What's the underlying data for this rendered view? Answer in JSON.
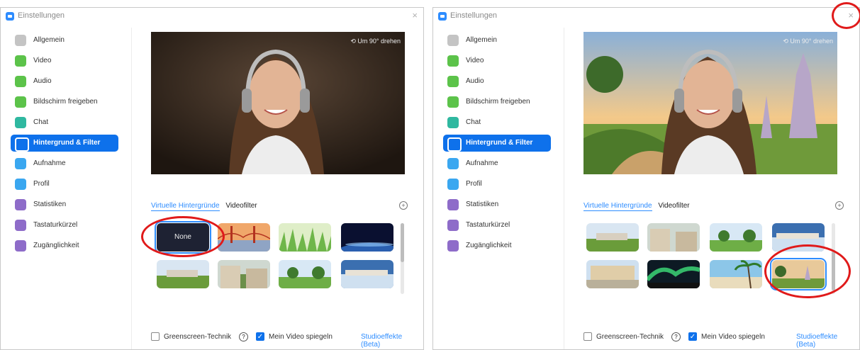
{
  "window_title": "Einstellungen",
  "close_glyph": "×",
  "nav": [
    {
      "label": "Allgemein",
      "icon": "gear-icon",
      "color": "#c4c4c4"
    },
    {
      "label": "Video",
      "icon": "video-camera-icon",
      "color": "#5cc34a"
    },
    {
      "label": "Audio",
      "icon": "headphones-icon",
      "color": "#5cc34a"
    },
    {
      "label": "Bildschirm freigeben",
      "icon": "share-screen-icon",
      "color": "#5cc34a"
    },
    {
      "label": "Chat",
      "icon": "chat-bubble-icon",
      "color": "#2fb8a0"
    },
    {
      "label": "Hintergrund & Filter",
      "icon": "background-filter-icon",
      "color": "#ffffff"
    },
    {
      "label": "Aufnahme",
      "icon": "record-icon",
      "color": "#3aa7f0"
    },
    {
      "label": "Profil",
      "icon": "profile-icon",
      "color": "#3aa7f0"
    },
    {
      "label": "Statistiken",
      "icon": "statistics-icon",
      "color": "#8e6cc9"
    },
    {
      "label": "Tastaturkürzel",
      "icon": "keyboard-icon",
      "color": "#8e6cc9"
    },
    {
      "label": "Zugänglichkeit",
      "icon": "accessibility-icon",
      "color": "#8e6cc9"
    }
  ],
  "active_nav": "Hintergrund & Filter",
  "rotate_label": "Um 90° drehen",
  "tab_virtual": "Virtuelle Hintergründe",
  "tab_video_filter": "Videofilter",
  "plus_glyph": "+",
  "none_label": "None",
  "greenscreen_label": "Greenscreen-Technik",
  "help_glyph": "?",
  "mirror_label": "Mein Video spiegeln",
  "mirror_checked": true,
  "greenscreen_checked": false,
  "check_glyph": "✓",
  "studio_label": "Studioeffekte (Beta)",
  "accent_color": "#0e71eb",
  "annotation_color": "#e01a1a"
}
